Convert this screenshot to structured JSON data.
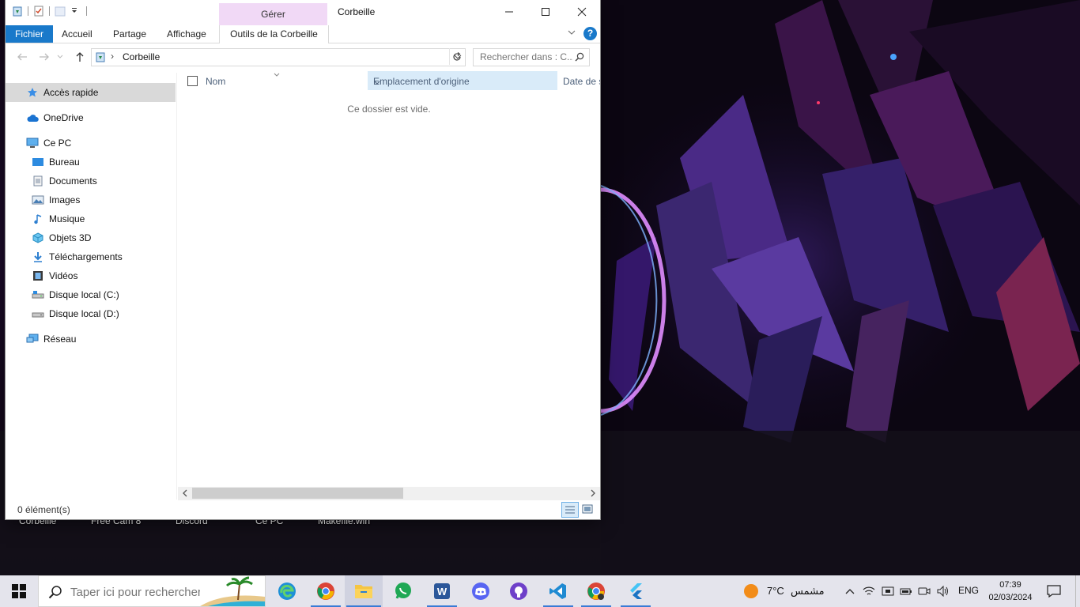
{
  "window": {
    "title": "Corbeille",
    "manage_tab": "Gérer",
    "ribbon_tabs": [
      "Fichier",
      "Accueil",
      "Partage",
      "Affichage",
      "Outils de la Corbeille"
    ],
    "address": {
      "crumb": "Corbeille"
    },
    "search_placeholder": "Rechercher dans : C...",
    "nav_pane": {
      "quick_access": "Accès rapide",
      "onedrive": "OneDrive",
      "this_pc": "Ce PC",
      "desktop": "Bureau",
      "documents": "Documents",
      "images": "Images",
      "music": "Musique",
      "objects3d": "Objets 3D",
      "downloads": "Téléchargements",
      "videos": "Vidéos",
      "disk_c": "Disque local (C:)",
      "disk_d": "Disque local (D:)",
      "network": "Réseau"
    },
    "columns": {
      "name": "Nom",
      "origin": "Emplacement d'origine",
      "date": "Date de s"
    },
    "empty_message": "Ce dossier est vide.",
    "status": {
      "count": "0 élément(s)"
    }
  },
  "desktop": {
    "icon_labels": [
      "Corbeille",
      "Free Cam 8",
      "Discord",
      "Ce PC",
      "Makefile.win"
    ]
  },
  "taskbar": {
    "search_placeholder": "Taper ici pour rechercher",
    "apps": [
      "edge-icon",
      "chrome-icon",
      "file-explorer-icon",
      "whatsapp-icon",
      "word-app-icon",
      "discord-icon",
      "github-icon",
      "vscode-icon",
      "chrome-dev-icon",
      "flutter-icon"
    ],
    "weather": {
      "temp": "7°C",
      "condition": "مشمس"
    },
    "language": "ENG",
    "time": "07:39",
    "date": "02/03/2024"
  },
  "colors": {
    "accent": "#1979ca",
    "manage_tab": "#f1d9f6",
    "selected_column": "#d9ebf9",
    "taskbar": "#e4e4ec"
  }
}
